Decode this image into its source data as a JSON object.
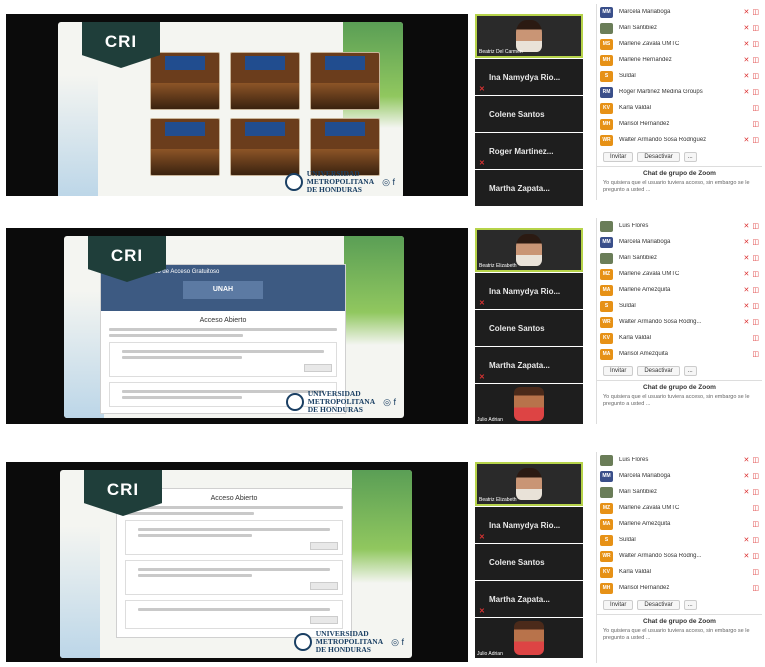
{
  "brand": {
    "badge": "CRI",
    "logo_lines": [
      "UNIVERSIDAD",
      "METROPOLITANA",
      "DE HONDURAS"
    ]
  },
  "colors": {
    "accent_green": "#7fbf45",
    "badge_bg": "#1f3e3a",
    "mic_off": "#d33333",
    "active_speaker_border": "#b6d34a"
  },
  "web": {
    "header": "Recurso Electrónico de Acceso Gratuitoso",
    "unah": "UNAH",
    "section_title": "Acceso Abierto"
  },
  "panels": [
    {
      "participants": [
        {
          "name": "",
          "caption": "Beatriz Del Carmen",
          "kind": "video"
        },
        {
          "name": "Ina Namydya Rio...",
          "kind": "name"
        },
        {
          "name": "Colene Santos",
          "kind": "name"
        },
        {
          "name": "Roger Martinez...",
          "kind": "name"
        },
        {
          "name": "Martha Zapata...",
          "kind": "name"
        }
      ],
      "sidebar": [
        {
          "initials": "MM",
          "name": "Marcela Mariaboga",
          "color": "b"
        },
        {
          "initials": "",
          "name": "Mari Santibiez",
          "color": "p"
        },
        {
          "initials": "MS",
          "name": "Marlene Zavala UMTC",
          "color": "o"
        },
        {
          "initials": "MH",
          "name": "Marlene Hernandez",
          "color": "o"
        },
        {
          "initials": "S",
          "name": "Suldal",
          "color": "o"
        },
        {
          "initials": "RM",
          "name": "Roger Martinez Medina Groups",
          "color": "b"
        },
        {
          "initials": "KV",
          "name": "Karla Valdal",
          "color": "o"
        },
        {
          "initials": "MH",
          "name": "Marisol Hernandez",
          "color": "o"
        },
        {
          "initials": "WR",
          "name": "Walter Armando Sosa Rodriguez",
          "color": "o"
        }
      ],
      "buttons": [
        "Invitar",
        "Desactivar",
        "..."
      ],
      "chat_title": "Chat de grupo de Zoom",
      "chat_preview": "Yo quisiera que el usuario tuviera acceso, sin embargo se le pregunto a usted ..."
    },
    {
      "participants": [
        {
          "name": "",
          "caption": "Beatriz Elizabeth",
          "kind": "video"
        },
        {
          "name": "Ina Namydya Rio...",
          "kind": "name"
        },
        {
          "name": "Colene Santos",
          "kind": "name"
        },
        {
          "name": "Martha Zapata...",
          "kind": "name"
        },
        {
          "name": "",
          "caption": "Julio Adrian",
          "kind": "cam"
        }
      ],
      "sidebar": [
        {
          "initials": "",
          "name": "Luis Flores",
          "color": "p"
        },
        {
          "initials": "MM",
          "name": "Marcela Mariaboga",
          "color": "b"
        },
        {
          "initials": "",
          "name": "Mari Santibiez",
          "color": "p"
        },
        {
          "initials": "MZ",
          "name": "Marlene Zavala UMTC",
          "color": "o"
        },
        {
          "initials": "MA",
          "name": "Marlene Amezquita",
          "color": "o"
        },
        {
          "initials": "S",
          "name": "Suldal",
          "color": "o"
        },
        {
          "initials": "WR",
          "name": "Walter Armando Sosa Rodrig...",
          "color": "o"
        },
        {
          "initials": "KV",
          "name": "Karla Valdal",
          "color": "o"
        },
        {
          "initials": "MA",
          "name": "Marisol Amezquita",
          "color": "o"
        }
      ],
      "buttons": [
        "Invitar",
        "Desactivar",
        "..."
      ],
      "chat_title": "Chat de grupo de Zoom",
      "chat_preview": "Yo quisiera que el usuario tuviera acceso, sin embargo se le pregunto a usted ..."
    },
    {
      "participants": [
        {
          "name": "",
          "caption": "Beatriz Elizabeth",
          "kind": "video"
        },
        {
          "name": "Ina Namydya Rio...",
          "kind": "name"
        },
        {
          "name": "Colene Santos",
          "kind": "name"
        },
        {
          "name": "Martha Zapata...",
          "kind": "name"
        },
        {
          "name": "",
          "caption": "Julio Adrian",
          "kind": "cam"
        }
      ],
      "sidebar": [
        {
          "initials": "",
          "name": "Luis Flores",
          "color": "p"
        },
        {
          "initials": "MM",
          "name": "Marcela Mariaboga",
          "color": "b"
        },
        {
          "initials": "",
          "name": "Mari Santibiez",
          "color": "p"
        },
        {
          "initials": "MZ",
          "name": "Marlene Zavala UMTC",
          "color": "o"
        },
        {
          "initials": "MA",
          "name": "Marlene Amezquita",
          "color": "o"
        },
        {
          "initials": "S",
          "name": "Suldal",
          "color": "o"
        },
        {
          "initials": "WR",
          "name": "Walter Armando Sosa Rodrig...",
          "color": "o"
        },
        {
          "initials": "KV",
          "name": "Karla Valdal",
          "color": "o"
        },
        {
          "initials": "MH",
          "name": "Marisol Hernandez",
          "color": "o"
        }
      ],
      "buttons": [
        "Invitar",
        "Desactivar",
        "..."
      ],
      "chat_title": "Chat de grupo de Zoom",
      "chat_preview": "Yo quisiera que el usuario tuviera acceso, sin embargo se le pregunto a usted ..."
    }
  ]
}
